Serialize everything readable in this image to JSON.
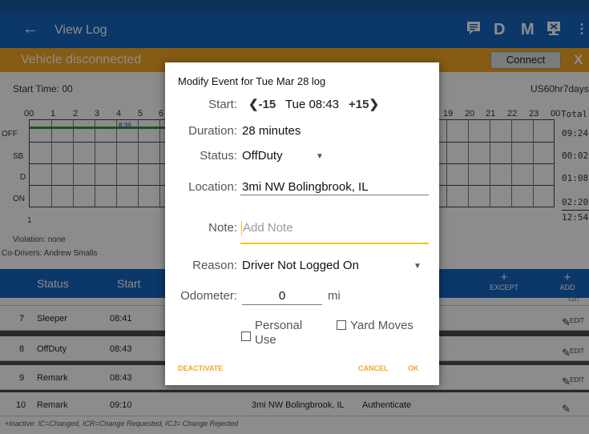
{
  "appbar": {
    "title": "View Log",
    "icons": [
      "message-icon",
      "D",
      "M",
      "device-icon",
      "more-icon"
    ]
  },
  "banner": {
    "message": "Vehicle disconnected",
    "connect_label": "Connect",
    "close_label": "X"
  },
  "log": {
    "start_time": "Start Time: 00",
    "cycle": "US60hr7days",
    "hours": [
      "00",
      "1",
      "2",
      "3",
      "4",
      "5",
      "6",
      "19",
      "20",
      "21",
      "22",
      "23",
      "00"
    ],
    "total_label": "Total",
    "rows": [
      "OFF",
      "SB",
      "D",
      "ON"
    ],
    "totals": [
      "09:24",
      "00:02",
      "01:08",
      "02:20",
      "12:54"
    ],
    "marker": "8:39",
    "left_num": "1",
    "violation": "Violation: none",
    "codrivers": "Co-Drivers: Andrew Smalls"
  },
  "table": {
    "headers": {
      "status": "Status",
      "start": "Start",
      "except": "EXCEPT",
      "add": "ADD",
      "edit": "EDIT"
    },
    "rows": [
      {
        "num": "7",
        "status": "Sleeper",
        "start": "08:41",
        "location": "",
        "note": ""
      },
      {
        "num": "8",
        "status": "OffDuty",
        "start": "08:43",
        "location": "",
        "note": ""
      },
      {
        "num": "9",
        "status": "Remark",
        "start": "08:43",
        "location": "",
        "note": ""
      },
      {
        "num": "10",
        "status": "Remark",
        "start": "09:10",
        "location": "3mi NW Bolingbrook, IL",
        "note": "Authenticate"
      }
    ],
    "legend": "+Inactive: IC=Changed, ICR=Change Requested, ICJ= Change Rejected"
  },
  "dialog": {
    "title": "Modify Event for Tue Mar 28 log",
    "start_label": "Start:",
    "minus_label": "-15",
    "plus_label": "+15",
    "start_value": "Tue 08:43",
    "duration_label": "Duration:",
    "duration_value": "28 minutes",
    "status_label": "Status:",
    "status_value": "OffDuty",
    "location_label": "Location:",
    "location_value": "3mi NW Bolingbrook, IL",
    "note_label": "Note:",
    "note_placeholder": "Add Note",
    "reason_label": "Reason:",
    "reason_value": "Driver Not Logged On",
    "odometer_label": "Odometer:",
    "odometer_value": "0",
    "odometer_unit": "mi",
    "personal_use_line1": "Personal",
    "personal_use_line2": "Use",
    "yard_moves_label": "Yard Moves",
    "deactivate_label": "DEACTIVATE",
    "cancel_label": "CANCEL",
    "ok_label": "OK"
  }
}
